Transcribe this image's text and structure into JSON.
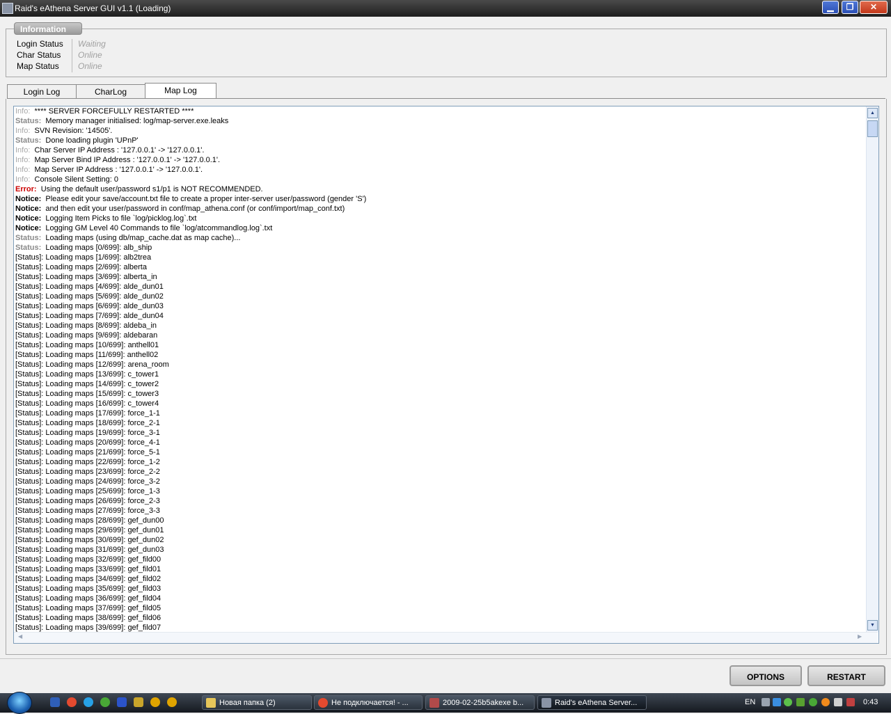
{
  "window": {
    "title": "Raid's eAthena Server GUI v1.1 (Loading)",
    "minimize": "▁",
    "maximize": "❐",
    "close": "✕"
  },
  "info": {
    "title": "Information",
    "rows": [
      {
        "label": "Login Status",
        "value": "Waiting"
      },
      {
        "label": "Char Status",
        "value": "Online"
      },
      {
        "label": "Map Status",
        "value": "Online"
      }
    ]
  },
  "tabs": [
    {
      "label": "Login Log",
      "active": false
    },
    {
      "label": "CharLog",
      "active": false
    },
    {
      "label": "Map Log",
      "active": true
    }
  ],
  "log": [
    {
      "prefix": "Info:",
      "type": "info",
      "text": "**** SERVER FORCEFULLY RESTARTED ****"
    },
    {
      "prefix": "Status:",
      "type": "status",
      "text": "Memory manager initialised: log/map-server.exe.leaks"
    },
    {
      "prefix": "Info:",
      "type": "info",
      "text": "SVN Revision: '14505'."
    },
    {
      "prefix": "Status:",
      "type": "status",
      "text": "Done loading plugin 'UPnP'"
    },
    {
      "prefix": "Info:",
      "type": "info",
      "text": "Char Server IP Address : '127.0.0.1' -> '127.0.0.1'."
    },
    {
      "prefix": "Info:",
      "type": "info",
      "text": "Map Server Bind IP Address : '127.0.0.1' -> '127.0.0.1'."
    },
    {
      "prefix": "Info:",
      "type": "info",
      "text": "Map Server IP Address : '127.0.0.1' -> '127.0.0.1'."
    },
    {
      "prefix": "Info:",
      "type": "info",
      "text": "Console Silent Setting: 0"
    },
    {
      "prefix": "Error:",
      "type": "error",
      "text": "Using the default user/password s1/p1 is NOT RECOMMENDED."
    },
    {
      "prefix": "Notice:",
      "type": "notice",
      "text": "Please edit your save/account.txt file to create a proper inter-server user/password (gender 'S')"
    },
    {
      "prefix": "Notice:",
      "type": "notice",
      "text": "and then edit your user/password in conf/map_athena.conf (or conf/import/map_conf.txt)"
    },
    {
      "prefix": "Notice:",
      "type": "notice",
      "text": "Logging Item Picks to file `log/picklog.log`.txt"
    },
    {
      "prefix": "Notice:",
      "type": "notice",
      "text": "Logging GM Level 40 Commands to file `log/atcommandlog.log`.txt"
    },
    {
      "prefix": "Status:",
      "type": "status",
      "text": "Loading maps (using db/map_cache.dat as map cache)..."
    },
    {
      "prefix": "Status:",
      "type": "status",
      "text": "Loading maps [0/699]: alb_ship"
    },
    {
      "prefix": "",
      "type": "plain",
      "text": "[Status]: Loading maps [1/699]: alb2trea"
    },
    {
      "prefix": "",
      "type": "plain",
      "text": "[Status]: Loading maps [2/699]: alberta"
    },
    {
      "prefix": "",
      "type": "plain",
      "text": "[Status]: Loading maps [3/699]: alberta_in"
    },
    {
      "prefix": "",
      "type": "plain",
      "text": "[Status]: Loading maps [4/699]: alde_dun01"
    },
    {
      "prefix": "",
      "type": "plain",
      "text": "[Status]: Loading maps [5/699]: alde_dun02"
    },
    {
      "prefix": "",
      "type": "plain",
      "text": "[Status]: Loading maps [6/699]: alde_dun03"
    },
    {
      "prefix": "",
      "type": "plain",
      "text": "[Status]: Loading maps [7/699]: alde_dun04"
    },
    {
      "prefix": "",
      "type": "plain",
      "text": "[Status]: Loading maps [8/699]: aldeba_in"
    },
    {
      "prefix": "",
      "type": "plain",
      "text": "[Status]: Loading maps [9/699]: aldebaran"
    },
    {
      "prefix": "",
      "type": "plain",
      "text": "[Status]: Loading maps [10/699]: anthell01"
    },
    {
      "prefix": "",
      "type": "plain",
      "text": "[Status]: Loading maps [11/699]: anthell02"
    },
    {
      "prefix": "",
      "type": "plain",
      "text": "[Status]: Loading maps [12/699]: arena_room"
    },
    {
      "prefix": "",
      "type": "plain",
      "text": "[Status]: Loading maps [13/699]: c_tower1"
    },
    {
      "prefix": "",
      "type": "plain",
      "text": "[Status]: Loading maps [14/699]: c_tower2"
    },
    {
      "prefix": "",
      "type": "plain",
      "text": "[Status]: Loading maps [15/699]: c_tower3"
    },
    {
      "prefix": "",
      "type": "plain",
      "text": "[Status]: Loading maps [16/699]: c_tower4"
    },
    {
      "prefix": "",
      "type": "plain",
      "text": "[Status]: Loading maps [17/699]: force_1-1"
    },
    {
      "prefix": "",
      "type": "plain",
      "text": "[Status]: Loading maps [18/699]: force_2-1"
    },
    {
      "prefix": "",
      "type": "plain",
      "text": "[Status]: Loading maps [19/699]: force_3-1"
    },
    {
      "prefix": "",
      "type": "plain",
      "text": "[Status]: Loading maps [20/699]: force_4-1"
    },
    {
      "prefix": "",
      "type": "plain",
      "text": "[Status]: Loading maps [21/699]: force_5-1"
    },
    {
      "prefix": "",
      "type": "plain",
      "text": "[Status]: Loading maps [22/699]: force_1-2"
    },
    {
      "prefix": "",
      "type": "plain",
      "text": "[Status]: Loading maps [23/699]: force_2-2"
    },
    {
      "prefix": "",
      "type": "plain",
      "text": "[Status]: Loading maps [24/699]: force_3-2"
    },
    {
      "prefix": "",
      "type": "plain",
      "text": "[Status]: Loading maps [25/699]: force_1-3"
    },
    {
      "prefix": "",
      "type": "plain",
      "text": "[Status]: Loading maps [26/699]: force_2-3"
    },
    {
      "prefix": "",
      "type": "plain",
      "text": "[Status]: Loading maps [27/699]: force_3-3"
    },
    {
      "prefix": "",
      "type": "plain",
      "text": "[Status]: Loading maps [28/699]: gef_dun00"
    },
    {
      "prefix": "",
      "type": "plain",
      "text": "[Status]: Loading maps [29/699]: gef_dun01"
    },
    {
      "prefix": "",
      "type": "plain",
      "text": "[Status]: Loading maps [30/699]: gef_dun02"
    },
    {
      "prefix": "",
      "type": "plain",
      "text": "[Status]: Loading maps [31/699]: gef_dun03"
    },
    {
      "prefix": "",
      "type": "plain",
      "text": "[Status]: Loading maps [32/699]: gef_fild00"
    },
    {
      "prefix": "",
      "type": "plain",
      "text": "[Status]: Loading maps [33/699]: gef_fild01"
    },
    {
      "prefix": "",
      "type": "plain",
      "text": "[Status]: Loading maps [34/699]: gef_fild02"
    },
    {
      "prefix": "",
      "type": "plain",
      "text": "[Status]: Loading maps [35/699]: gef_fild03"
    },
    {
      "prefix": "",
      "type": "plain",
      "text": "[Status]: Loading maps [36/699]: gef_fild04"
    },
    {
      "prefix": "",
      "type": "plain",
      "text": "[Status]: Loading maps [37/699]: gef_fild05"
    },
    {
      "prefix": "",
      "type": "plain",
      "text": "[Status]: Loading maps [38/699]: gef_fild06"
    },
    {
      "prefix": "",
      "type": "plain",
      "text": "[Status]: Loading maps [39/699]: gef_fild07"
    }
  ],
  "buttons": {
    "options": "OPTIONS",
    "restart": "RESTART"
  },
  "taskbar": {
    "tasks": [
      {
        "label": "Новая папка (2)",
        "icon": "folder-icon",
        "active": false
      },
      {
        "label": "Не подключается! - ...",
        "icon": "chrome-icon",
        "active": false
      },
      {
        "label": "2009-02-25b5akexe b...",
        "icon": "app-icon",
        "active": false
      },
      {
        "label": "Raid's eAthena Server...",
        "icon": "server-icon",
        "active": true
      }
    ],
    "language": "EN",
    "clock": "0:43"
  },
  "colors": {
    "info_prefix": "#a8a8a8",
    "status_prefix": "#8a8a8a",
    "error_prefix": "#cc0000",
    "status_value": "#a0a0a0"
  }
}
